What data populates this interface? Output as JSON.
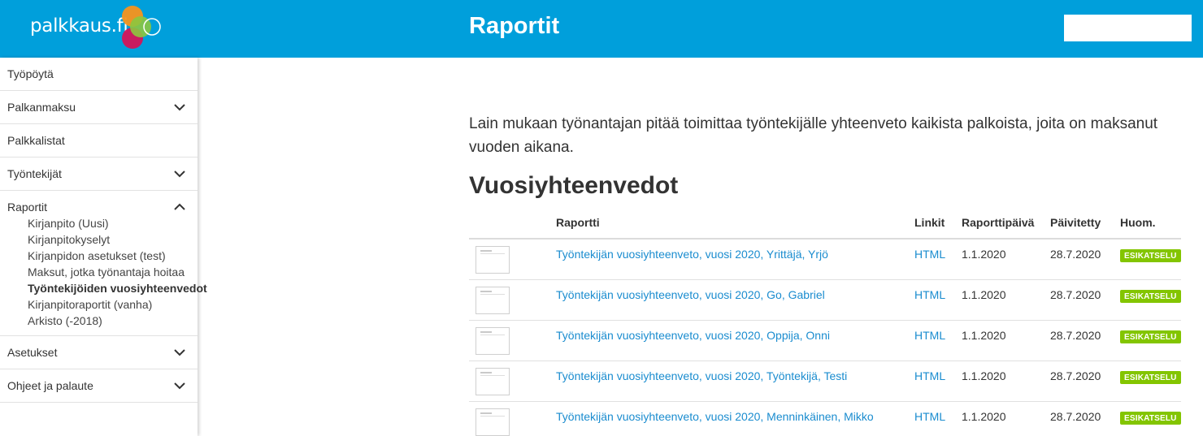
{
  "app": {
    "logo_text": "palkkaus.fi",
    "page_title": "Raportit",
    "colors": {
      "header": "#009fdb",
      "link": "#1a8ccf",
      "badge": "#83c500"
    }
  },
  "sidebar": {
    "items": [
      {
        "label": "Työpöytä"
      },
      {
        "label": "Palkanmaksu",
        "icon": "chevron-down-icon"
      },
      {
        "label": "Palkkalistat"
      },
      {
        "label": "Työntekijät",
        "icon": "chevron-down-icon"
      },
      {
        "label": "Raportit",
        "icon": "chevron-up-icon",
        "children": [
          "Kirjanpito (Uusi)",
          "Kirjanpitokyselyt",
          "Kirjanpidon asetukset (test)",
          "Maksut, jotka työnantaja hoitaa",
          "Työntekijöiden vuosiyhteenvedot",
          "Kirjanpitoraportit (vanha)",
          "Arkisto (-2018)"
        ],
        "active_child": "Työntekijöiden vuosiyhteenvedot"
      },
      {
        "label": "Asetukset",
        "icon": "chevron-down-icon"
      },
      {
        "label": "Ohjeet ja palaute",
        "icon": "chevron-down-icon"
      }
    ]
  },
  "main": {
    "intro": "Lain mukaan työnantajan pitää toimittaa työntekijälle yhteenveto kaikista palkoista, joita on maksanut vuoden aikana.",
    "section_title": "Vuosiyhteenvedot",
    "table": {
      "headers": [
        "",
        "Raportti",
        "Linkit",
        "Raporttipäivä",
        "Päivitetty",
        "Huom."
      ],
      "rows": [
        {
          "report": "Työntekijän vuosiyhteenveto, vuosi 2020, Yrittäjä, Yrjö",
          "link": "HTML",
          "report_date": "1.1.2020",
          "updated": "28.7.2020",
          "note": "ESIKATSELU"
        },
        {
          "report": "Työntekijän vuosiyhteenveto, vuosi 2020, Go, Gabriel",
          "link": "HTML",
          "report_date": "1.1.2020",
          "updated": "28.7.2020",
          "note": "ESIKATSELU"
        },
        {
          "report": "Työntekijän vuosiyhteenveto, vuosi 2020, Oppija, Onni",
          "link": "HTML",
          "report_date": "1.1.2020",
          "updated": "28.7.2020",
          "note": "ESIKATSELU"
        },
        {
          "report": "Työntekijän vuosiyhteenveto, vuosi 2020, Työntekijä, Testi",
          "link": "HTML",
          "report_date": "1.1.2020",
          "updated": "28.7.2020",
          "note": "ESIKATSELU"
        },
        {
          "report": "Työntekijän vuosiyhteenveto, vuosi 2020, Menninkäinen, Mikko",
          "link": "HTML",
          "report_date": "1.1.2020",
          "updated": "28.7.2020",
          "note": "ESIKATSELU"
        }
      ]
    }
  }
}
